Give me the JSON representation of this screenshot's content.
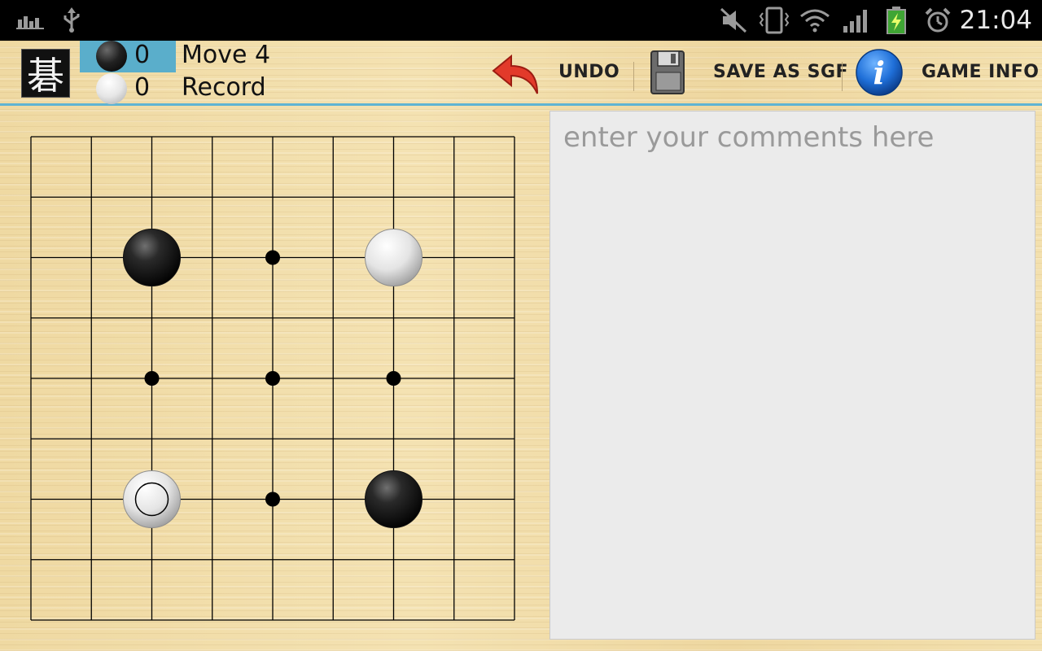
{
  "status_bar": {
    "time": "21:04",
    "icons": [
      "chart-notification-icon",
      "usb-icon",
      "mute-icon",
      "vibrate-icon",
      "wifi-icon",
      "signal-icon",
      "battery-charging-icon",
      "alarm-icon"
    ]
  },
  "action_bar": {
    "app_icon_glyph": "碁",
    "black_captures": "0",
    "white_captures": "0",
    "move_label": "Move 4",
    "mode_label": "Record",
    "undo_label": "UNDO",
    "save_label": "SAVE AS SGF",
    "info_label": "GAME INFO",
    "accent_color": "#5fb4d3"
  },
  "board": {
    "size": 9,
    "hoshi": [
      [
        2,
        2
      ],
      [
        2,
        6
      ],
      [
        4,
        4
      ],
      [
        6,
        2
      ],
      [
        6,
        6
      ],
      [
        4,
        2
      ],
      [
        4,
        6
      ],
      [
        2,
        4
      ],
      [
        6,
        4
      ]
    ],
    "stones": [
      {
        "color": "black",
        "col": 2,
        "row": 2
      },
      {
        "color": "white",
        "col": 6,
        "row": 2
      },
      {
        "color": "white",
        "col": 2,
        "row": 6,
        "last_move": true
      },
      {
        "color": "black",
        "col": 6,
        "row": 6
      }
    ],
    "line_color": "#000000"
  },
  "comments": {
    "placeholder": "enter your comments here",
    "value": ""
  }
}
